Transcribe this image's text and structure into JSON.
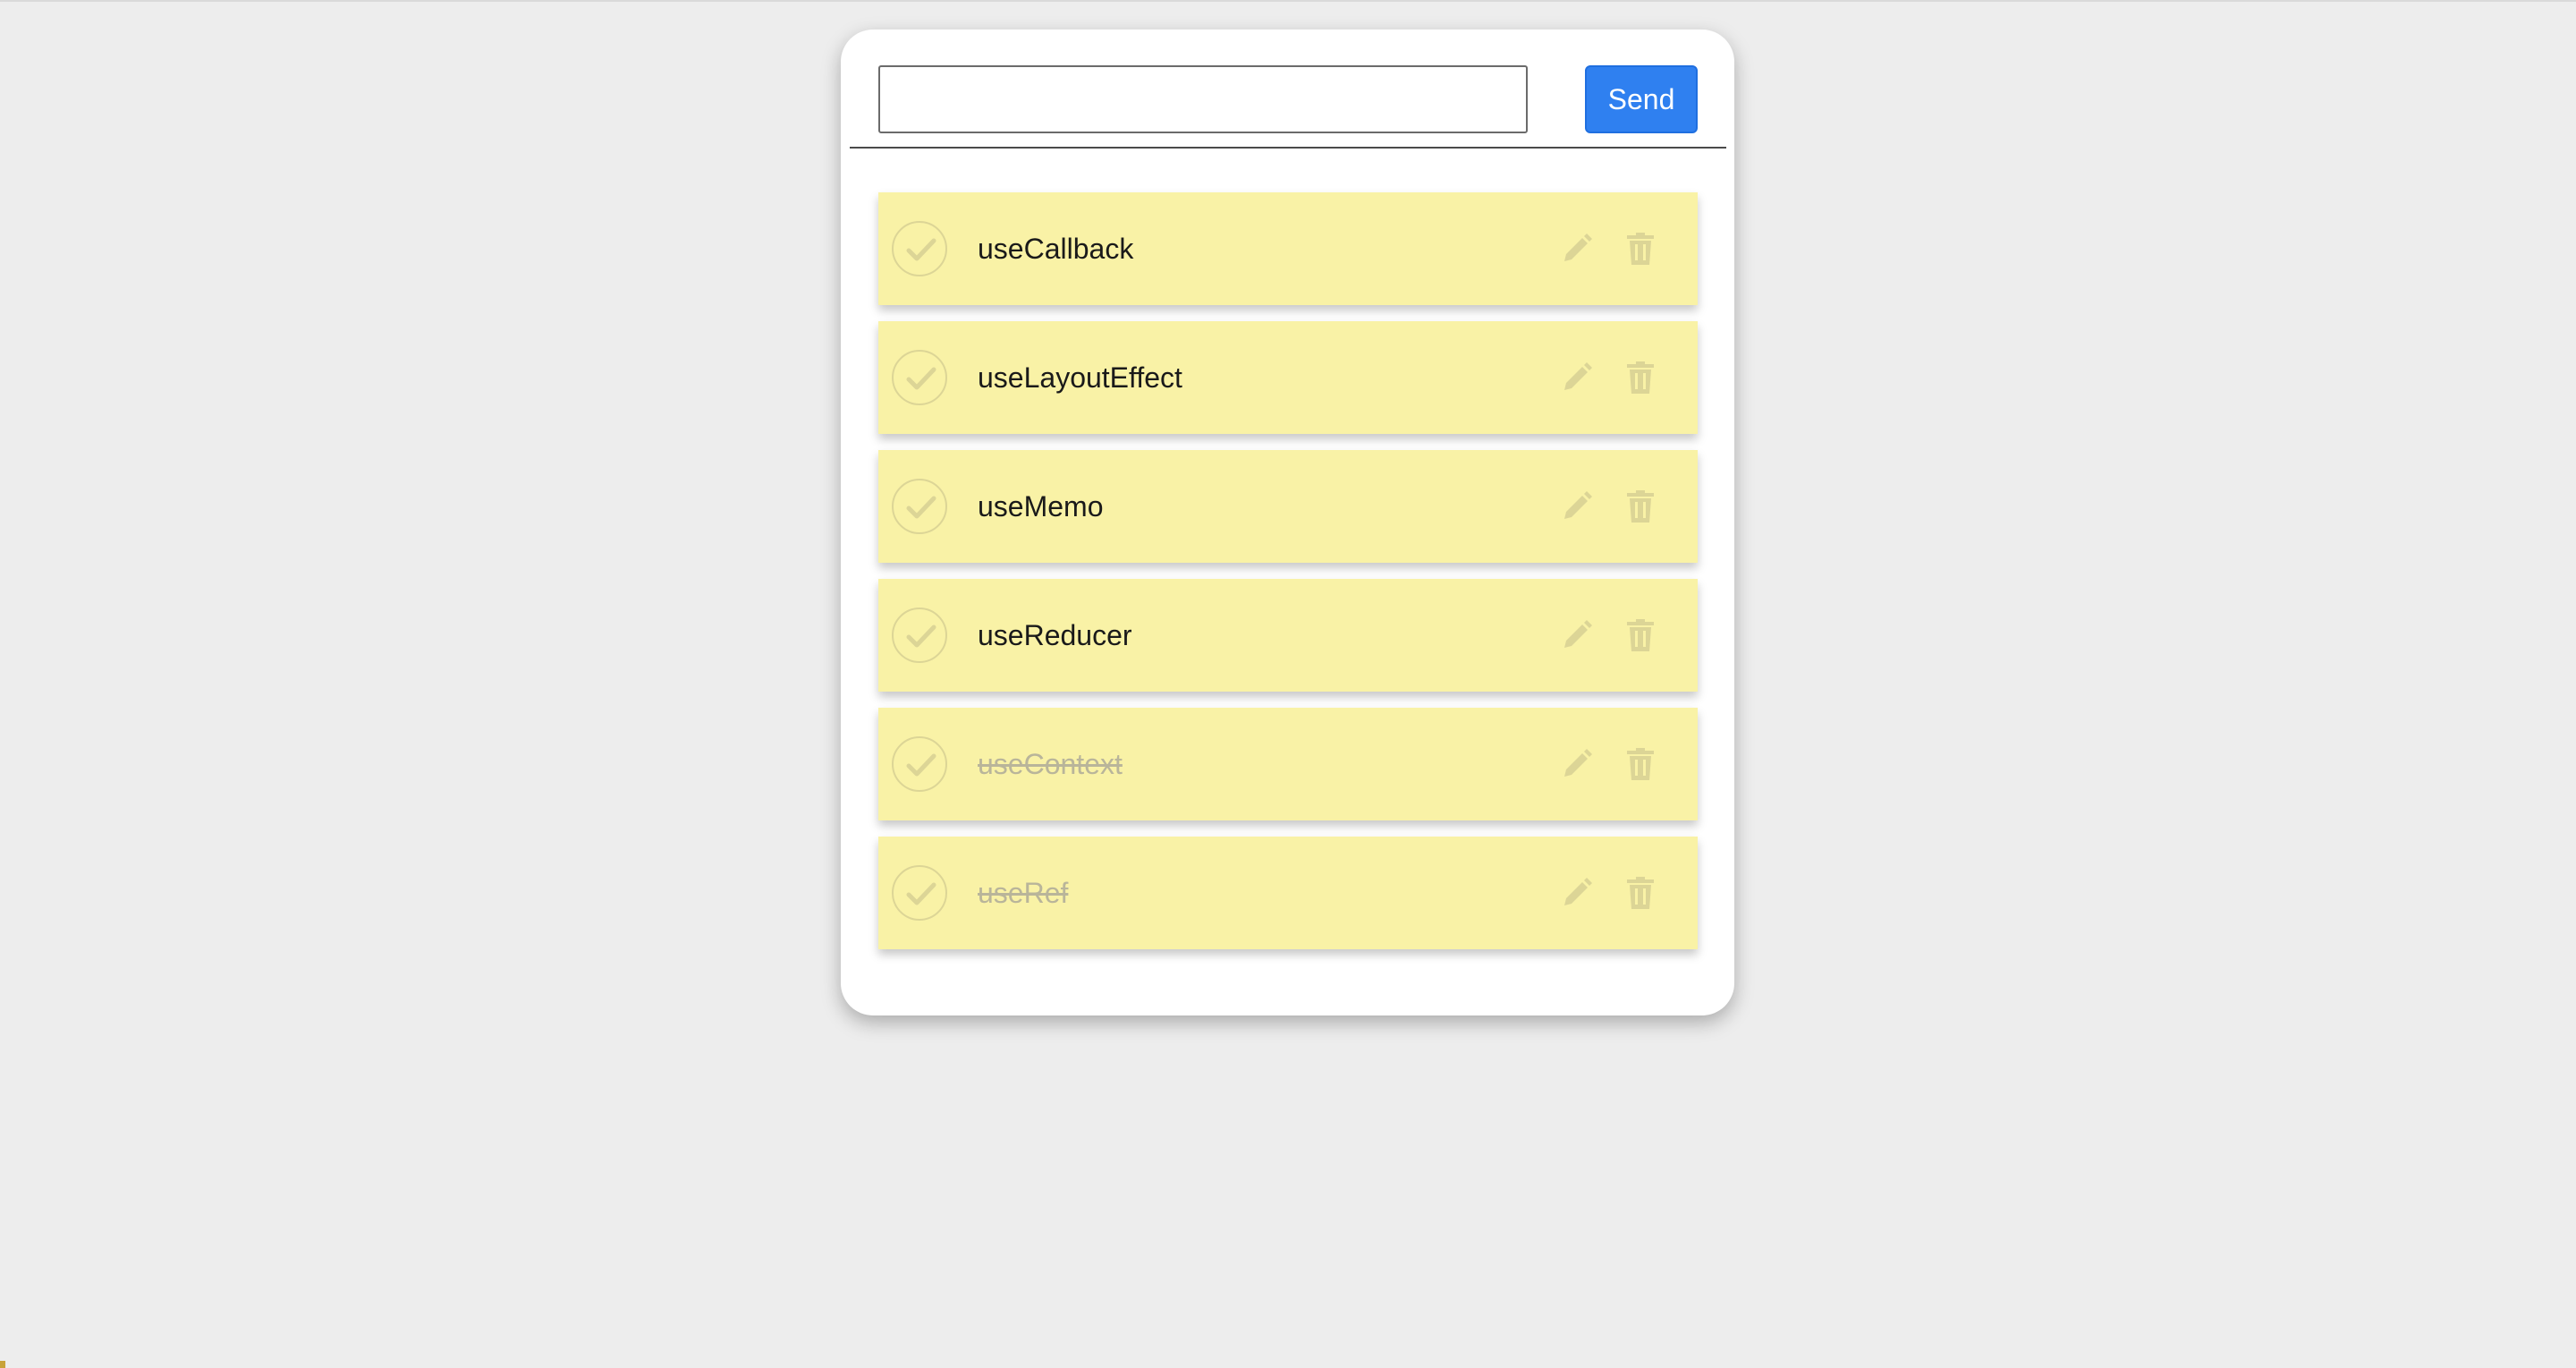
{
  "input": {
    "value": "",
    "placeholder": ""
  },
  "send_label": "Send",
  "colors": {
    "background": "#ededed",
    "card": "#ffffff",
    "send_button": "#2f80f0",
    "note": "#f9f2a6",
    "icon": "#dcd596"
  },
  "todos": [
    {
      "text": "useCallback",
      "done": false
    },
    {
      "text": "useLayoutEffect",
      "done": false
    },
    {
      "text": "useMemo",
      "done": false
    },
    {
      "text": "useReducer",
      "done": false
    },
    {
      "text": "useContext",
      "done": true
    },
    {
      "text": "useRef",
      "done": true
    }
  ],
  "icons": {
    "check": "check-icon",
    "edit": "pencil-icon",
    "delete": "trash-icon"
  }
}
